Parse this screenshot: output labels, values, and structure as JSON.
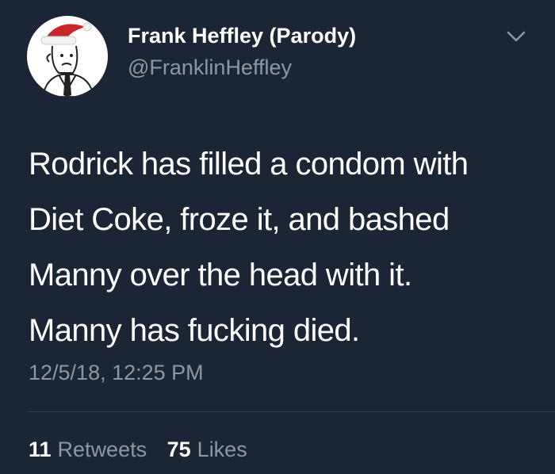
{
  "tweet": {
    "author": {
      "display_name": "Frank Heffley (Parody)",
      "handle": "@FranklinHeffley",
      "avatar_icon": "cartoon-man-santa-hat-avatar"
    },
    "menu_icon": "chevron-down-icon",
    "text_lines": [
      "Rodrick has filled a condom with",
      "Diet Coke, froze it, and bashed",
      "Manny over the head with it.",
      "Manny has fucking died."
    ],
    "timestamp": "12/5/18, 12:25 PM",
    "stats": {
      "retweets_count": "11",
      "retweets_label": "Retweets",
      "likes_count": "75",
      "likes_label": "Likes"
    }
  },
  "colors": {
    "background": "#1b2535",
    "primary_text": "#ffffff",
    "secondary_text": "#8a98a8",
    "divider": "#2f3d50"
  }
}
